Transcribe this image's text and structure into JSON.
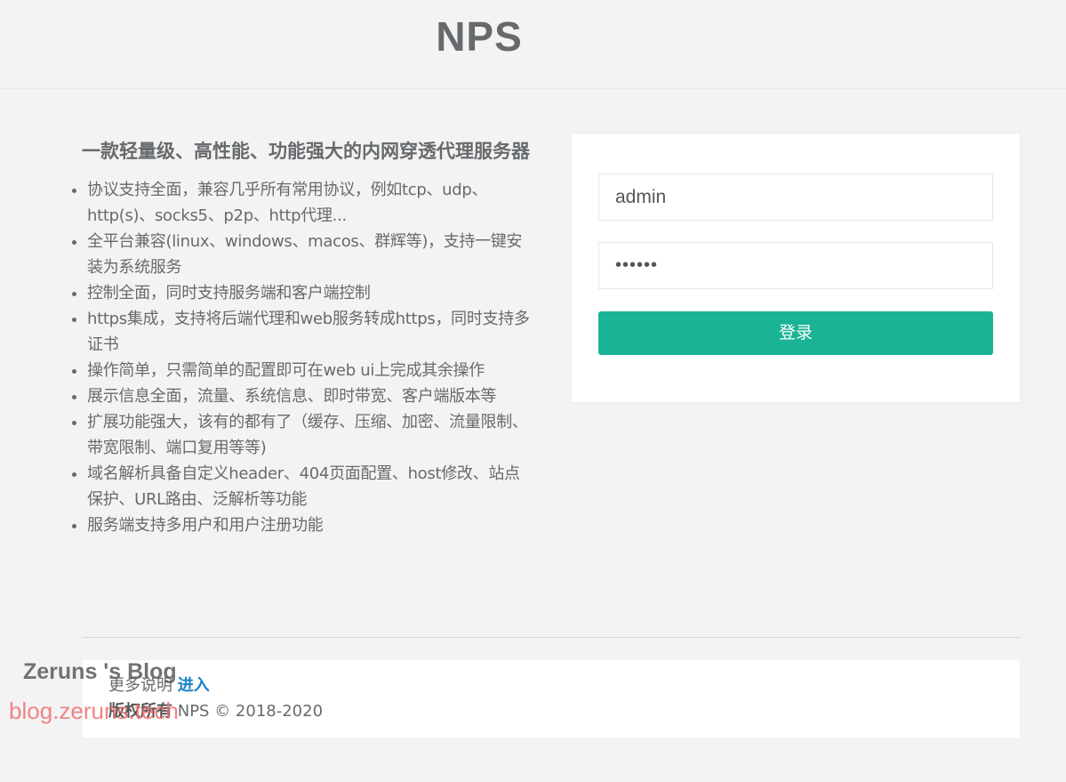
{
  "header": {
    "title": "NPS"
  },
  "intro": {
    "heading": "一款轻量级、高性能、功能强大的内网穿透代理服务器",
    "features": [
      "协议支持全面，兼容几乎所有常用协议，例如tcp、udp、http(s)、socks5、p2p、http代理...",
      "全平台兼容(linux、windows、macos、群辉等)，支持一键安装为系统服务",
      "控制全面，同时支持服务端和客户端控制",
      "https集成，支持将后端代理和web服务转成https，同时支持多证书",
      "操作简单，只需简单的配置即可在web ui上完成其余操作",
      "展示信息全面，流量、系统信息、即时带宽、客户端版本等",
      "扩展功能强大，该有的都有了（缓存、压缩、加密、流量限制、带宽限制、端口复用等等)",
      "域名解析具备自定义header、404页面配置、host修改、站点保护、URL路由、泛解析等功能",
      "服务端支持多用户和用户注册功能"
    ]
  },
  "login": {
    "username_value": "admin",
    "password_value": "••••••",
    "submit_label": "登录"
  },
  "footer": {
    "more_label": "更多说明",
    "more_link": "进入",
    "copyright_label": "版权所有",
    "copyright_text": "NPS © 2018-2020"
  },
  "watermark": {
    "line1": "Zeruns 's Blog",
    "line2": "blog.zeruns.tech"
  },
  "colors": {
    "accent": "#1ab394",
    "link": "#1c84c6",
    "text": "#676a6c",
    "background": "#f3f3f4"
  }
}
